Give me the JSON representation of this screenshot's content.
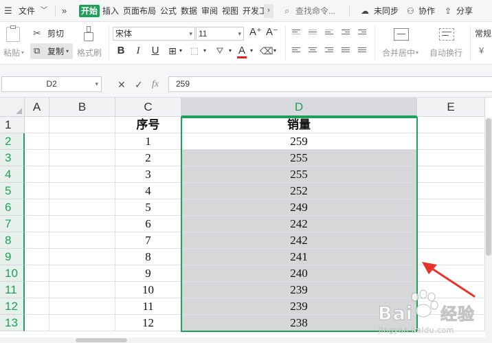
{
  "menubar": {
    "file": "文件",
    "tabs": [
      "开始",
      "插入",
      "页面布局",
      "公式",
      "数据",
      "审阅",
      "视图",
      "开发工"
    ],
    "search_placeholder": "查找命令...",
    "sync": "未同步",
    "collab": "协作",
    "share": "分享"
  },
  "ribbon": {
    "paste": "粘贴",
    "cut": "剪切",
    "copy": "复制",
    "format_painter": "格式刷",
    "font_name": "宋体",
    "font_size": "11",
    "bold": "B",
    "italic": "I",
    "underline": "U",
    "font_grow": "A⁺",
    "font_shrink": "A⁻",
    "merge_center": "合并居中",
    "wrap_text": "自动换行",
    "number_format": "常规",
    "currency_symbol": "¥",
    "font_color_accent": "#e02020"
  },
  "formulabar": {
    "name_box": "D2",
    "cancel": "✕",
    "confirm": "✓",
    "fx": "fx",
    "value": "259"
  },
  "sheet": {
    "columns": [
      "A",
      "B",
      "C",
      "D",
      "E"
    ],
    "rows": [
      "1",
      "2",
      "3",
      "4",
      "5",
      "6",
      "7",
      "8",
      "9",
      "10",
      "11",
      "12",
      "13"
    ],
    "header": {
      "c": "序号",
      "d": "销量"
    },
    "data": [
      {
        "c": "1",
        "d": "259"
      },
      {
        "c": "2",
        "d": "255"
      },
      {
        "c": "3",
        "d": "255"
      },
      {
        "c": "4",
        "d": "252"
      },
      {
        "c": "5",
        "d": "249"
      },
      {
        "c": "6",
        "d": "242"
      },
      {
        "c": "7",
        "d": "242"
      },
      {
        "c": "8",
        "d": "241"
      },
      {
        "c": "9",
        "d": "240"
      },
      {
        "c": "10",
        "d": "239"
      },
      {
        "c": "11",
        "d": "239"
      },
      {
        "c": "12",
        "d": "238"
      }
    ],
    "selected_column": "D",
    "selected_range": "D2:D13",
    "active_cell": "D2"
  },
  "colors": {
    "accent_green": "#1fa05a",
    "selection_fill": "#d6d7d8",
    "arrow_red": "#e8332a"
  },
  "watermark": {
    "brand": "Bai",
    "brand_suffix": "经验",
    "url": "jingyan.baidu.com"
  }
}
